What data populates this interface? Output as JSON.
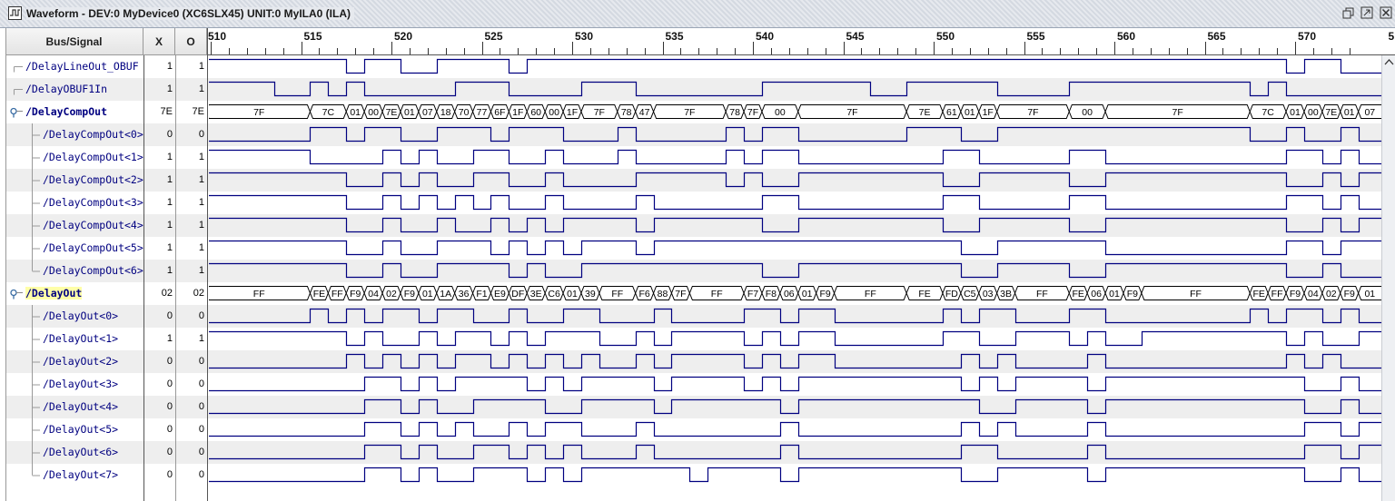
{
  "window": {
    "title": "Waveform - DEV:0 MyDevice0 (XC6SLX45) UNIT:0 MyILA0 (ILA)",
    "icons": [
      "waveform-app-icon",
      "restore-icon",
      "maximize-icon",
      "close-icon"
    ]
  },
  "columns": {
    "bus_signal": "Bus/Signal",
    "x": "X",
    "o": "O"
  },
  "timeline": {
    "start": 510,
    "end": 573.8,
    "label_step": 5,
    "minor_step": 1,
    "labels": [
      "510",
      "515",
      "520",
      "525",
      "530",
      "535",
      "540",
      "545",
      "550",
      "555",
      "560",
      "565",
      "570",
      "5"
    ]
  },
  "colors": {
    "wave": "#000080",
    "row_alt": "#eeeeee",
    "highlight": "#ffffa8"
  },
  "signals": [
    {
      "name": "/DelayLineOut_OBUF",
      "x": "1",
      "o": "1",
      "type": "bit",
      "level": 1,
      "tree": "leaf-top",
      "hl": false,
      "t": [
        517.5,
        518.5,
        520.5,
        522.5,
        526.5,
        527.5,
        569.5,
        570.5,
        572.5
      ]
    },
    {
      "name": "/DelayOBUF1In",
      "x": "1",
      "o": "1",
      "type": "bit",
      "level": 1,
      "tree": "leaf-top",
      "hl": false,
      "t": [
        513.5,
        515.5,
        516.5,
        517.5,
        518.5,
        523.5,
        526.5,
        530.5,
        533.5,
        540.5,
        546.5,
        548.5,
        553.5,
        557.5,
        567.5,
        568.5,
        569.5
      ]
    },
    {
      "name": "/DelayCompOut",
      "x": "7E",
      "o": "7E",
      "type": "bus",
      "level": 1,
      "tree": "group",
      "hl": false,
      "segs": [
        [
          "7F",
          510
        ],
        [
          "7C",
          515.5
        ],
        [
          "01",
          517.5
        ],
        [
          "00",
          518.5
        ],
        [
          "7E",
          519.5
        ],
        [
          "01",
          520.5
        ],
        [
          "07",
          521.5
        ],
        [
          "18",
          522.5
        ],
        [
          "70",
          523.5
        ],
        [
          "77",
          524.5
        ],
        [
          "6F",
          525.5
        ],
        [
          "1F",
          526.5
        ],
        [
          "60",
          527.5
        ],
        [
          "00",
          528.5
        ],
        [
          "1F",
          529.5
        ],
        [
          "7F",
          530.5
        ],
        [
          "78",
          532.5
        ],
        [
          "47",
          533.5
        ],
        [
          "7F",
          534.5
        ],
        [
          "78",
          538.5
        ],
        [
          "7F",
          539.5
        ],
        [
          "00",
          540.5
        ],
        [
          "7F",
          542.5
        ],
        [
          "7E",
          548.5
        ],
        [
          "61",
          550.5
        ],
        [
          "01",
          551.5
        ],
        [
          "1F",
          552.5
        ],
        [
          "7F",
          553.5
        ],
        [
          "00",
          557.5
        ],
        [
          "7F",
          559.5
        ],
        [
          "7C",
          567.5
        ],
        [
          "01",
          569.5
        ],
        [
          "00",
          570.5
        ],
        [
          "7E",
          571.5
        ],
        [
          "01",
          572.5
        ],
        [
          "07",
          573.5
        ]
      ]
    },
    {
      "name": "/DelayCompOut<0>",
      "x": "0",
      "o": "0",
      "type": "bit",
      "level": 0,
      "tree": "child",
      "hl": false,
      "t": [
        515.5,
        517.5,
        518.5,
        520.5,
        522.5,
        525.5,
        526.5,
        529.5,
        532.5,
        533.5,
        538.5,
        539.5,
        540.5,
        542.5,
        548.5,
        551.5,
        553.5,
        567.5,
        569.5,
        570.5,
        572.5,
        573.5
      ]
    },
    {
      "name": "/DelayCompOut<1>",
      "x": "1",
      "o": "1",
      "type": "bit",
      "level": 1,
      "tree": "child",
      "hl": false,
      "t": [
        515.5,
        519.5,
        520.5,
        521.5,
        522.5,
        524.5,
        526.5,
        528.5,
        529.5,
        532.5,
        533.5,
        538.5,
        539.5,
        540.5,
        542.5,
        550.5,
        552.5,
        557.5,
        559.5,
        569.5,
        571.5,
        572.5,
        573.5
      ]
    },
    {
      "name": "/DelayCompOut<2>",
      "x": "1",
      "o": "1",
      "type": "bit",
      "level": 1,
      "tree": "child",
      "hl": false,
      "t": [
        517.5,
        519.5,
        520.5,
        521.5,
        522.5,
        524.5,
        526.5,
        528.5,
        529.5,
        533.5,
        538.5,
        539.5,
        540.5,
        542.5,
        550.5,
        552.5,
        557.5,
        559.5,
        569.5,
        571.5,
        572.5,
        573.5
      ]
    },
    {
      "name": "/DelayCompOut<3>",
      "x": "1",
      "o": "1",
      "type": "bit",
      "level": 1,
      "tree": "child",
      "hl": false,
      "t": [
        517.5,
        519.5,
        520.5,
        521.5,
        522.5,
        523.5,
        524.5,
        525.5,
        526.5,
        528.5,
        529.5,
        533.5,
        534.5,
        540.5,
        542.5,
        550.5,
        552.5,
        557.5,
        559.5,
        569.5,
        571.5,
        572.5,
        573.5
      ]
    },
    {
      "name": "/DelayCompOut<4>",
      "x": "1",
      "o": "1",
      "type": "bit",
      "level": 1,
      "tree": "child",
      "hl": false,
      "t": [
        517.5,
        519.5,
        520.5,
        522.5,
        523.5,
        525.5,
        526.5,
        527.5,
        528.5,
        529.5,
        533.5,
        534.5,
        540.5,
        542.5,
        550.5,
        552.5,
        557.5,
        559.5,
        569.5,
        571.5,
        572.5,
        573.5
      ]
    },
    {
      "name": "/DelayCompOut<5>",
      "x": "1",
      "o": "1",
      "type": "bit",
      "level": 1,
      "tree": "child",
      "hl": false,
      "t": [
        517.5,
        519.5,
        520.5,
        522.5,
        525.5,
        526.5,
        527.5,
        528.5,
        529.5,
        530.5,
        533.5,
        534.5,
        551.5,
        553.5,
        559.5,
        569.5,
        571.5,
        572.5
      ]
    },
    {
      "name": "/DelayCompOut<6>",
      "x": "1",
      "o": "1",
      "type": "bit",
      "level": 1,
      "tree": "child",
      "hl": false,
      "t": [
        517.5,
        519.5,
        520.5,
        522.5,
        526.5,
        527.5,
        528.5,
        530.5,
        540.5,
        542.5,
        551.5,
        553.5,
        557.5,
        559.5,
        569.5,
        571.5,
        572.5
      ]
    },
    {
      "name": "/DelayOut",
      "x": "02",
      "o": "02",
      "type": "bus",
      "level": 1,
      "tree": "group",
      "hl": true,
      "segs": [
        [
          "FF",
          510
        ],
        [
          "FE",
          515.5
        ],
        [
          "FF",
          516.5
        ],
        [
          "F9",
          517.5
        ],
        [
          "04",
          518.5
        ],
        [
          "02",
          519.5
        ],
        [
          "F9",
          520.5
        ],
        [
          "01",
          521.5
        ],
        [
          "1A",
          522.5
        ],
        [
          "36",
          523.5
        ],
        [
          "F1",
          524.5
        ],
        [
          "E9",
          525.5
        ],
        [
          "DF",
          526.5
        ],
        [
          "3E",
          527.5
        ],
        [
          "C6",
          528.5
        ],
        [
          "01",
          529.5
        ],
        [
          "39",
          530.5
        ],
        [
          "FF",
          531.5
        ],
        [
          "F6",
          533.5
        ],
        [
          "88",
          534.5
        ],
        [
          "7F",
          535.5
        ],
        [
          "FF",
          536.5
        ],
        [
          "F7",
          539.5
        ],
        [
          "F8",
          540.5
        ],
        [
          "06",
          541.5
        ],
        [
          "01",
          542.5
        ],
        [
          "F9",
          543.5
        ],
        [
          "FF",
          544.5
        ],
        [
          "FE",
          548.5
        ],
        [
          "FD",
          550.5
        ],
        [
          "C5",
          551.5
        ],
        [
          "03",
          552.5
        ],
        [
          "3B",
          553.5
        ],
        [
          "FF",
          554.5
        ],
        [
          "FE",
          557.5
        ],
        [
          "06",
          558.5
        ],
        [
          "01",
          559.5
        ],
        [
          "F9",
          560.5
        ],
        [
          "FF",
          561.5
        ],
        [
          "FE",
          567.5
        ],
        [
          "FF",
          568.5
        ],
        [
          "F9",
          569.5
        ],
        [
          "04",
          570.5
        ],
        [
          "02",
          571.5
        ],
        [
          "F9",
          572.5
        ],
        [
          "01",
          573.5
        ]
      ]
    },
    {
      "name": "/DelayOut<0>",
      "x": "0",
      "o": "0",
      "type": "bit",
      "level": 0,
      "tree": "child",
      "hl": false,
      "t": [
        515.5,
        516.5,
        517.5,
        518.5,
        519.5,
        521.5,
        522.5,
        524.5,
        526.5,
        527.5,
        529.5,
        531.5,
        534.5,
        535.5,
        539.5,
        541.5,
        542.5,
        544.5,
        550.5,
        551.5,
        552.5,
        554.5,
        557.5,
        559.5,
        567.5,
        568.5,
        569.5,
        571.5,
        572.5,
        573.5
      ]
    },
    {
      "name": "/DelayOut<1>",
      "x": "1",
      "o": "1",
      "type": "bit",
      "level": 1,
      "tree": "child",
      "hl": false,
      "t": [
        517.5,
        518.5,
        519.5,
        521.5,
        522.5,
        523.5,
        525.5,
        526.5,
        527.5,
        528.5,
        531.5,
        533.5,
        534.5,
        535.5,
        539.5,
        540.5,
        541.5,
        542.5,
        544.5,
        550.5,
        552.5,
        554.5,
        557.5,
        558.5,
        559.5,
        561.5,
        569.5,
        570.5,
        571.5,
        573.5
      ]
    },
    {
      "name": "/DelayOut<2>",
      "x": "0",
      "o": "0",
      "type": "bit",
      "level": 0,
      "tree": "child",
      "hl": false,
      "t": [
        517.5,
        518.5,
        519.5,
        520.5,
        521.5,
        522.5,
        523.5,
        525.5,
        526.5,
        527.5,
        528.5,
        529.5,
        530.5,
        531.5,
        533.5,
        534.5,
        535.5,
        539.5,
        540.5,
        541.5,
        542.5,
        544.5,
        551.5,
        552.5,
        553.5,
        554.5,
        558.5,
        559.5,
        569.5,
        570.5,
        571.5,
        572.5
      ]
    },
    {
      "name": "/DelayOut<3>",
      "x": "0",
      "o": "0",
      "type": "bit",
      "level": 0,
      "tree": "child",
      "hl": false,
      "t": [
        518.5,
        520.5,
        521.5,
        522.5,
        523.5,
        527.5,
        528.5,
        529.5,
        530.5,
        534.5,
        535.5,
        539.5,
        540.5,
        541.5,
        542.5,
        551.5,
        552.5,
        553.5,
        554.5,
        558.5,
        559.5,
        570.5,
        572.5,
        573.5
      ]
    },
    {
      "name": "/DelayOut<4>",
      "x": "0",
      "o": "0",
      "type": "bit",
      "level": 0,
      "tree": "child",
      "hl": false,
      "t": [
        518.5,
        520.5,
        521.5,
        522.5,
        524.5,
        528.5,
        530.5,
        534.5,
        535.5,
        541.5,
        542.5,
        552.5,
        554.5,
        558.5,
        559.5,
        570.5,
        572.5,
        573.5
      ]
    },
    {
      "name": "/DelayOut<5>",
      "x": "0",
      "o": "0",
      "type": "bit",
      "level": 0,
      "tree": "child",
      "hl": false,
      "t": [
        518.5,
        520.5,
        521.5,
        522.5,
        523.5,
        524.5,
        526.5,
        527.5,
        528.5,
        530.5,
        533.5,
        534.5,
        541.5,
        542.5,
        551.5,
        552.5,
        553.5,
        554.5,
        558.5,
        559.5,
        570.5,
        572.5,
        573.5
      ]
    },
    {
      "name": "/DelayOut<6>",
      "x": "0",
      "o": "0",
      "type": "bit",
      "level": 0,
      "tree": "child",
      "hl": false,
      "t": [
        518.5,
        520.5,
        521.5,
        522.5,
        524.5,
        526.5,
        527.5,
        528.5,
        529.5,
        530.5,
        533.5,
        534.5,
        541.5,
        542.5,
        551.5,
        553.5,
        558.5,
        559.5,
        570.5,
        572.5,
        573.5
      ]
    },
    {
      "name": "/DelayOut<7>",
      "x": "0",
      "o": "0",
      "type": "bit",
      "level": 0,
      "tree": "child",
      "hl": false,
      "t": [
        518.5,
        520.5,
        521.5,
        522.5,
        524.5,
        527.5,
        528.5,
        529.5,
        530.5,
        536.5,
        537.5,
        541.5,
        542.5,
        551.5,
        553.5,
        558.5,
        559.5,
        570.5,
        572.5,
        573.5
      ]
    }
  ]
}
